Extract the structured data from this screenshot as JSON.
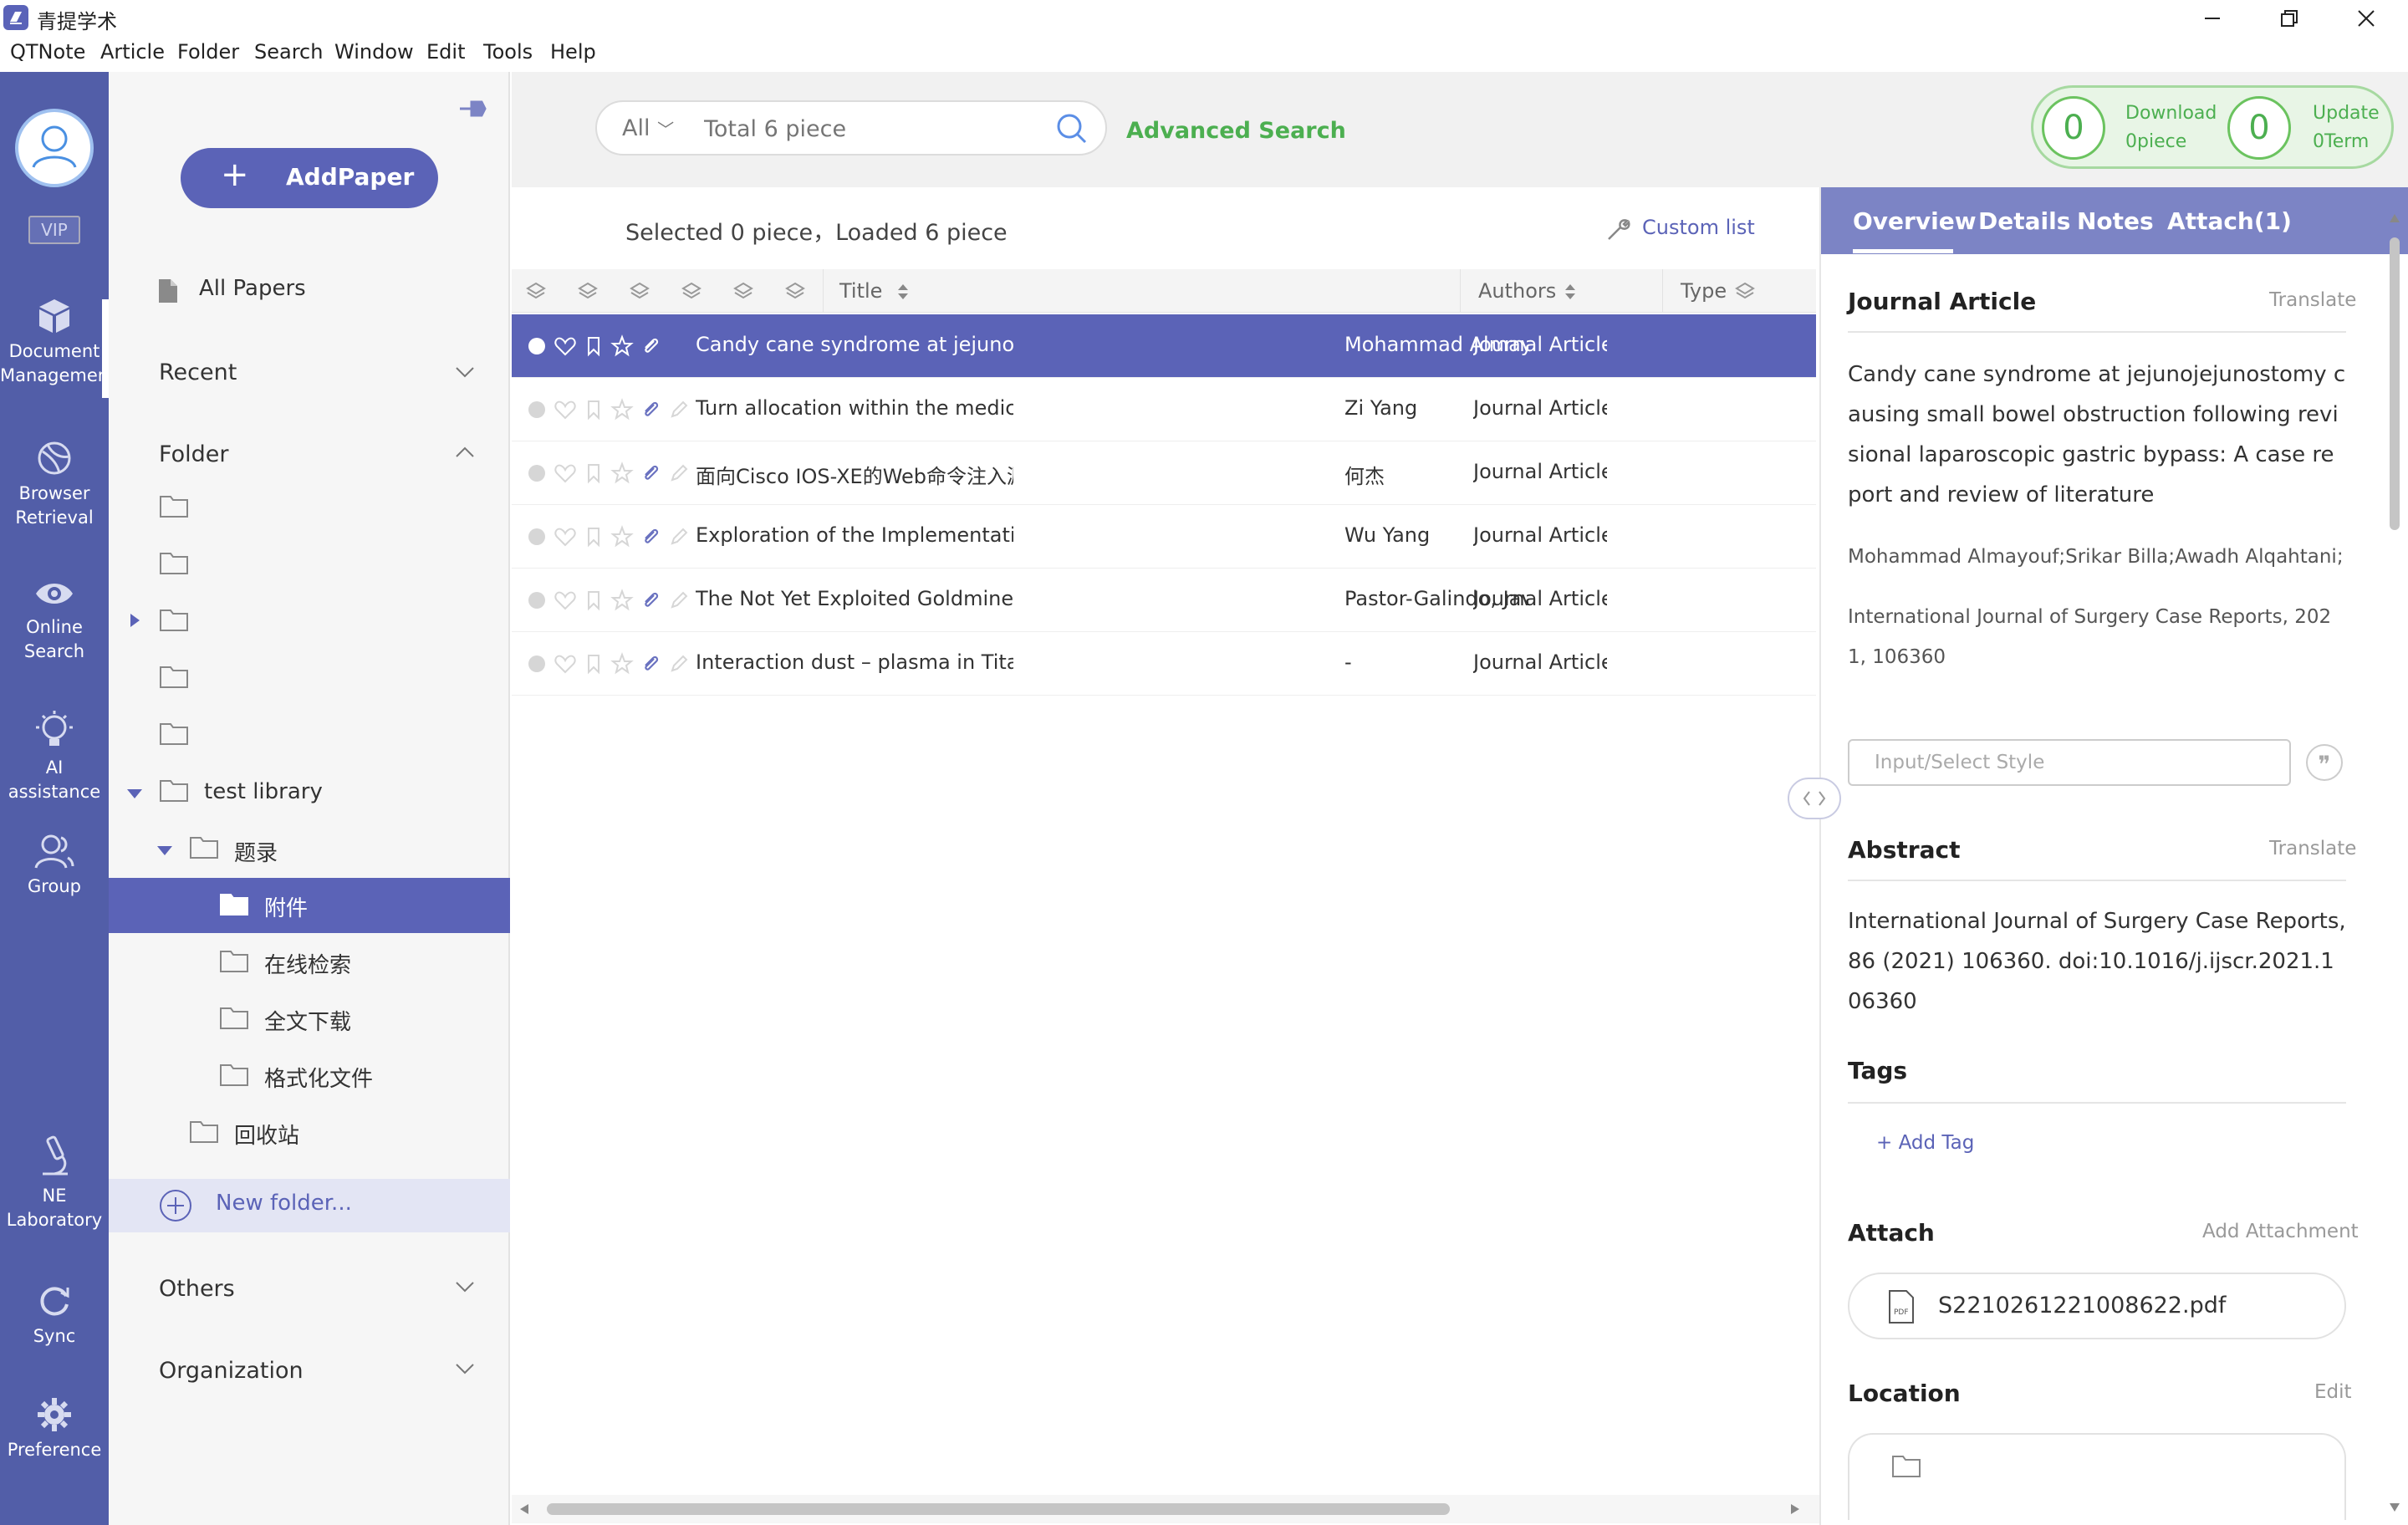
{
  "app": {
    "title": "青提学术"
  },
  "menu": [
    "QTNote",
    "Article",
    "Folder",
    "Search",
    "Window",
    "Edit",
    "Tools",
    "Help"
  ],
  "nav": {
    "vip": "VIP",
    "items": [
      {
        "label1": "Document",
        "label2": "Managemen",
        "icon": "cube-icon"
      },
      {
        "label1": "Browser",
        "label2": "Retrieval",
        "icon": "globe-icon"
      },
      {
        "label1": "Online",
        "label2": "Search",
        "icon": "eye-icon"
      },
      {
        "label1": "AI assistance",
        "label2": "",
        "icon": "ai-bulb-icon"
      },
      {
        "label1": "Group",
        "label2": "",
        "icon": "group-icon"
      },
      {
        "label1": "NE",
        "label2": "Laboratory",
        "icon": "microscope-icon"
      },
      {
        "label1": "Sync",
        "label2": "",
        "icon": "sync-icon"
      },
      {
        "label1": "Preference",
        "label2": "",
        "icon": "gear-icon"
      }
    ]
  },
  "folders": {
    "add_paper": "AddPaper",
    "all_papers": "All Papers",
    "recent": "Recent",
    "folder": "Folder",
    "test_library": "test library",
    "sub1": "题录",
    "sub1_children": [
      "附件",
      "在线检索",
      "全文下载",
      "格式化文件"
    ],
    "recycle": "回收站",
    "new_folder": "New folder...",
    "others": "Others",
    "organization": "Organization"
  },
  "search": {
    "scope": "All",
    "placeholder": "Total 6 piece",
    "advanced": "Advanced Search"
  },
  "counters": {
    "download_count": "0",
    "download_label": "Download",
    "download_sub": "0piece",
    "update_count": "0",
    "update_label": "Update",
    "update_sub": "0Term"
  },
  "list": {
    "info": "Selected 0 piece，Loaded 6 piece",
    "custom": "Custom list",
    "columns": {
      "title": "Title",
      "authors": "Authors",
      "type": "Type"
    },
    "rows": [
      {
        "title": "Candy cane syndrome at jejunojejunostomy causing small bowel obstruction following revisional laparoscopic gastric bypass",
        "authors": "Mohammad Almayouf",
        "type": "Journal Article"
      },
      {
        "title": "Turn allocation within the medical-service-seeking party in Chinese acute care",
        "authors": "Zi Yang",
        "type": "Journal Article"
      },
      {
        "title": "面向Cisco IOS-XE的Web命令注入漏洞检测",
        "authors": "何杰",
        "type": "Journal Article"
      },
      {
        "title": "Exploration of the Implementation of Carbon Neutralization in the Field of",
        "authors": "Wu Yang",
        "type": "Journal Article"
      },
      {
        "title": "The Not Yet Exploited Goldmine of OSINT: Opportunities, Open Challenges",
        "authors": "Pastor-Galindo, Javier",
        "type": "Journal Article"
      },
      {
        "title": "Interaction dust – plasma in Titan ' s ionosphere: feedbacks on the gas",
        "authors": "-",
        "type": "Journal Article"
      }
    ]
  },
  "detail": {
    "tabs": [
      "Overview",
      "Details",
      "Notes",
      "Attach(1)"
    ],
    "type_heading": "Journal Article",
    "translate": "Translate",
    "title": "Candy cane syndrome at jejunojejunostomy causing small bowel obstruction following revisional laparoscopic gastric bypass: A case report and review of literature",
    "authors": "Mohammad Almayouf;Srikar Billa;Awadh Alqahtani;",
    "journal": "International Journal of Surgery Case Reports, 2021, 106360",
    "style_placeholder": "Input/Select Style",
    "abstract_heading": "Abstract",
    "abstract": "International Journal of Surgery Case Reports, 86 (2021) 106360. doi:10.1016/j.ijscr.2021.106360",
    "tags_heading": "Tags",
    "add_tag": "+ Add Tag",
    "attach_heading": "Attach",
    "add_attachment": "Add Attachment",
    "attach_file": "S2210261221008622.pdf",
    "location_heading": "Location",
    "edit": "Edit"
  },
  "colors": {
    "accent": "#5b63b7",
    "nav": "#525ea8",
    "green": "#4caf50",
    "tabbar": "#7c84c5"
  }
}
